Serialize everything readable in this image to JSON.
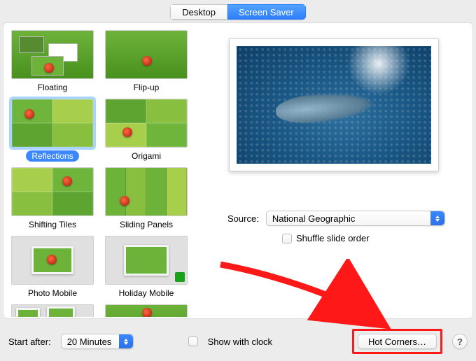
{
  "tabs": {
    "desktop": "Desktop",
    "screensaver": "Screen Saver",
    "selected": "screensaver"
  },
  "screensavers": [
    {
      "id": "floating",
      "label": "Floating"
    },
    {
      "id": "flip-up",
      "label": "Flip-up"
    },
    {
      "id": "reflections",
      "label": "Reflections",
      "selected": true
    },
    {
      "id": "origami",
      "label": "Origami"
    },
    {
      "id": "shifting-tiles",
      "label": "Shifting Tiles"
    },
    {
      "id": "sliding-panels",
      "label": "Sliding Panels"
    },
    {
      "id": "photo-mobile",
      "label": "Photo Mobile"
    },
    {
      "id": "holiday-mobile",
      "label": "Holiday Mobile"
    }
  ],
  "source": {
    "label": "Source:",
    "value": "National Geographic",
    "shuffle_label": "Shuffle slide order",
    "shuffle_checked": false
  },
  "footer": {
    "start_after_label": "Start after:",
    "start_after_value": "20 Minutes",
    "show_with_clock_label": "Show with clock",
    "show_with_clock_checked": false,
    "hot_corners_label": "Hot Corners…",
    "help_label": "?"
  },
  "colors": {
    "accent": "#3a87ff",
    "highlight": "#ff1818"
  }
}
